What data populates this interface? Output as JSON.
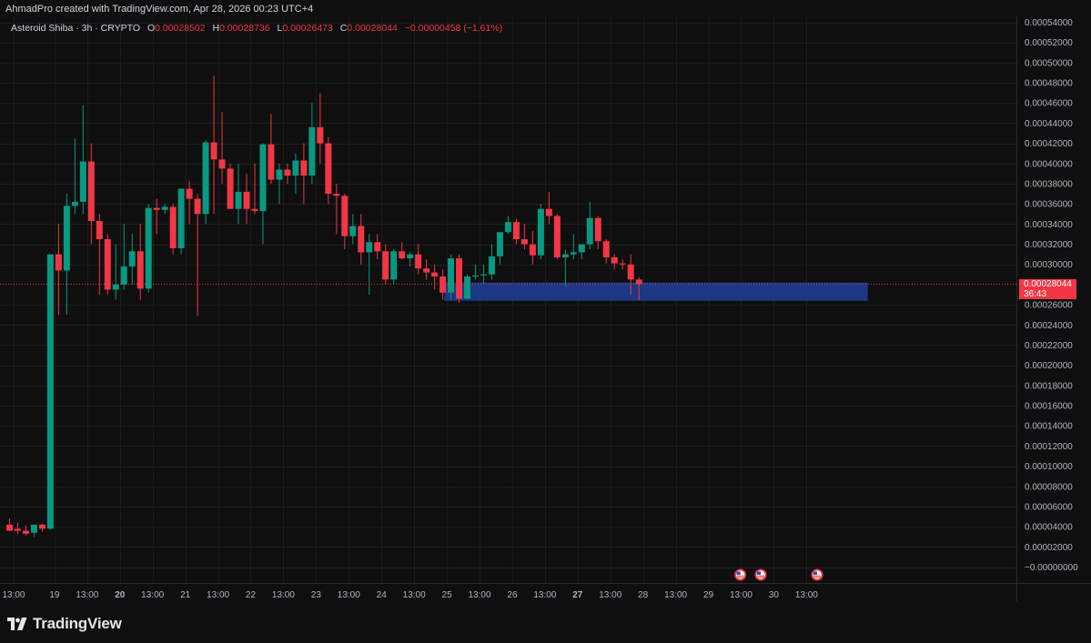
{
  "header": {
    "attribution": "AhmadPro created with TradingView.com, Apr 28, 2026 00:23 UTC+4"
  },
  "legend": {
    "symbol": "Asteroid Shiba · 3h · CRYPTO",
    "open_label": "O",
    "open": "0.00028502",
    "high_label": "H",
    "high": "0.00028736",
    "low_label": "L",
    "low": "0.00026473",
    "close_label": "C",
    "close": "0.00028044",
    "change": "−0.00000458 (−1.61%)"
  },
  "price_label": {
    "price": "0.00028044",
    "countdown": "36:43"
  },
  "brand": {
    "name": "TradingView",
    "logo_icon": "tradingview-logo-icon"
  },
  "colors": {
    "up": "#089981",
    "down": "#f23645",
    "zone": "#1e3a8a",
    "background": "#0f0f0f"
  },
  "chart_data": {
    "type": "candlestick",
    "timeframe": "3h",
    "y_ticks": [
      "0.00054000",
      "0.00052000",
      "0.00050000",
      "0.00048000",
      "0.00046000",
      "0.00044000",
      "0.00042000",
      "0.00040000",
      "0.00038000",
      "0.00036000",
      "0.00034000",
      "0.00032000",
      "0.00030000",
      "0.00028044",
      "0.00026000",
      "0.00024000",
      "0.00022000",
      "0.00020000",
      "0.00018000",
      "0.00016000",
      "0.00014000",
      "0.00012000",
      "0.00010000",
      "0.00008000",
      "0.00006000",
      "0.00004000",
      "0.00002000",
      "−0.00000000"
    ],
    "y_tick_values": [
      0.00054,
      0.00052,
      0.0005,
      0.00048,
      0.00046,
      0.00044,
      0.00042,
      0.0004,
      0.00038,
      0.00036,
      0.00034,
      0.00032,
      0.0003,
      0.00028044,
      0.00026,
      0.00024,
      0.00022,
      0.0002,
      0.00018,
      0.00016,
      0.00014,
      0.00012,
      0.0001,
      8e-05,
      6e-05,
      4e-05,
      2e-05,
      0
    ],
    "ylim": [
      -1e-06,
      0.000545
    ],
    "x_ticks": [
      {
        "label": "13:00",
        "bar": 0.5,
        "bold": false
      },
      {
        "label": "19",
        "bar": 5.5,
        "bold": false
      },
      {
        "label": "13:00",
        "bar": 9.5,
        "bold": false
      },
      {
        "label": "20",
        "bar": 13.5,
        "bold": true
      },
      {
        "label": "13:00",
        "bar": 17.5,
        "bold": false
      },
      {
        "label": "21",
        "bar": 21.5,
        "bold": false
      },
      {
        "label": "13:00",
        "bar": 25.5,
        "bold": false
      },
      {
        "label": "22",
        "bar": 29.5,
        "bold": false
      },
      {
        "label": "13:00",
        "bar": 33.5,
        "bold": false
      },
      {
        "label": "23",
        "bar": 37.5,
        "bold": false
      },
      {
        "label": "13:00",
        "bar": 41.5,
        "bold": false
      },
      {
        "label": "24",
        "bar": 45.5,
        "bold": false
      },
      {
        "label": "13:00",
        "bar": 49.5,
        "bold": false
      },
      {
        "label": "25",
        "bar": 53.5,
        "bold": false
      },
      {
        "label": "13:00",
        "bar": 57.5,
        "bold": false
      },
      {
        "label": "26",
        "bar": 61.5,
        "bold": false
      },
      {
        "label": "13:00",
        "bar": 65.5,
        "bold": false
      },
      {
        "label": "27",
        "bar": 69.5,
        "bold": true
      },
      {
        "label": "13:00",
        "bar": 73.5,
        "bold": false
      },
      {
        "label": "28",
        "bar": 77.5,
        "bold": false
      },
      {
        "label": "13:00",
        "bar": 81.5,
        "bold": false
      },
      {
        "label": "29",
        "bar": 85.5,
        "bold": false
      },
      {
        "label": "13:00",
        "bar": 89.5,
        "bold": false
      },
      {
        "label": "30",
        "bar": 93.5,
        "bold": false
      },
      {
        "label": "13:00",
        "bar": 97.5,
        "bold": false
      }
    ],
    "candles": [
      {
        "o": 4.2e-05,
        "h": 4.8e-05,
        "l": 3.6e-05,
        "c": 3.6e-05
      },
      {
        "o": 3.8e-05,
        "h": 4.4e-05,
        "l": 3.3e-05,
        "c": 3.6e-05
      },
      {
        "o": 3.6e-05,
        "h": 4.1e-05,
        "l": 3.1e-05,
        "c": 3.3e-05
      },
      {
        "o": 3.4e-05,
        "h": 4.2e-05,
        "l": 3e-05,
        "c": 4.2e-05
      },
      {
        "o": 4.2e-05,
        "h": 4.3e-05,
        "l": 3.5e-05,
        "c": 3.8e-05
      },
      {
        "o": 3.8e-05,
        "h": 0.00031,
        "l": 3.7e-05,
        "c": 0.00031
      },
      {
        "o": 0.00031,
        "h": 0.00034,
        "l": 0.00025,
        "c": 0.000294
      },
      {
        "o": 0.000294,
        "h": 0.00037,
        "l": 0.00025,
        "c": 0.000358
      },
      {
        "o": 0.000358,
        "h": 0.000425,
        "l": 0.00035,
        "c": 0.000362
      },
      {
        "o": 0.000362,
        "h": 0.000458,
        "l": 0.00035,
        "c": 0.000402
      },
      {
        "o": 0.000402,
        "h": 0.00042,
        "l": 0.00032,
        "c": 0.000343
      },
      {
        "o": 0.000343,
        "h": 0.00035,
        "l": 0.00027,
        "c": 0.000325
      },
      {
        "o": 0.000325,
        "h": 0.00033,
        "l": 0.00027,
        "c": 0.000275
      },
      {
        "o": 0.000275,
        "h": 0.00032,
        "l": 0.000265,
        "c": 0.00028
      },
      {
        "o": 0.00028,
        "h": 0.00034,
        "l": 0.000275,
        "c": 0.000298
      },
      {
        "o": 0.000298,
        "h": 0.00033,
        "l": 0.00028,
        "c": 0.000313
      },
      {
        "o": 0.000313,
        "h": 0.00034,
        "l": 0.000265,
        "c": 0.000276
      },
      {
        "o": 0.000276,
        "h": 0.00036,
        "l": 0.000272,
        "c": 0.000356
      },
      {
        "o": 0.000356,
        "h": 0.000365,
        "l": 0.00033,
        "c": 0.000354
      },
      {
        "o": 0.000354,
        "h": 0.00036,
        "l": 0.00035,
        "c": 0.000357
      },
      {
        "o": 0.000357,
        "h": 0.00036,
        "l": 0.00031,
        "c": 0.000316
      },
      {
        "o": 0.000316,
        "h": 0.000375,
        "l": 0.00031,
        "c": 0.000375
      },
      {
        "o": 0.000375,
        "h": 0.000383,
        "l": 0.00034,
        "c": 0.000365
      },
      {
        "o": 0.000365,
        "h": 0.00037,
        "l": 0.000249,
        "c": 0.00035
      },
      {
        "o": 0.00035,
        "h": 0.000423,
        "l": 0.00034,
        "c": 0.000421
      },
      {
        "o": 0.000421,
        "h": 0.000487,
        "l": 0.00035,
        "c": 0.000404
      },
      {
        "o": 0.000404,
        "h": 0.000451,
        "l": 0.00038,
        "c": 0.000395
      },
      {
        "o": 0.000395,
        "h": 0.0004,
        "l": 0.00036,
        "c": 0.000355
      },
      {
        "o": 0.000355,
        "h": 0.0004,
        "l": 0.00034,
        "c": 0.000372
      },
      {
        "o": 0.000372,
        "h": 0.00039,
        "l": 0.00034,
        "c": 0.000355
      },
      {
        "o": 0.000355,
        "h": 0.0004,
        "l": 0.00035,
        "c": 0.000353
      },
      {
        "o": 0.000353,
        "h": 0.00042,
        "l": 0.00032,
        "c": 0.000419
      },
      {
        "o": 0.000419,
        "h": 0.000449,
        "l": 0.00038,
        "c": 0.000384
      },
      {
        "o": 0.000384,
        "h": 0.0004,
        "l": 0.00036,
        "c": 0.000394
      },
      {
        "o": 0.000394,
        "h": 0.0004,
        "l": 0.00038,
        "c": 0.000388
      },
      {
        "o": 0.000388,
        "h": 0.00041,
        "l": 0.00037,
        "c": 0.000403
      },
      {
        "o": 0.000403,
        "h": 0.00042,
        "l": 0.00036,
        "c": 0.000388
      },
      {
        "o": 0.000388,
        "h": 0.00046,
        "l": 0.00038,
        "c": 0.000436
      },
      {
        "o": 0.000436,
        "h": 0.00047,
        "l": 0.0004,
        "c": 0.00042
      },
      {
        "o": 0.00042,
        "h": 0.000426,
        "l": 0.00036,
        "c": 0.00037
      },
      {
        "o": 0.00037,
        "h": 0.00038,
        "l": 0.00033,
        "c": 0.000368
      },
      {
        "o": 0.000368,
        "h": 0.00037,
        "l": 0.000315,
        "c": 0.000328
      },
      {
        "o": 0.000328,
        "h": 0.00035,
        "l": 0.00032,
        "c": 0.000338
      },
      {
        "o": 0.000338,
        "h": 0.00035,
        "l": 0.0003,
        "c": 0.000312
      },
      {
        "o": 0.000312,
        "h": 0.00033,
        "l": 0.00027,
        "c": 0.000322
      },
      {
        "o": 0.000322,
        "h": 0.00033,
        "l": 0.000305,
        "c": 0.000313
      },
      {
        "o": 0.000313,
        "h": 0.00032,
        "l": 0.00028,
        "c": 0.000285
      },
      {
        "o": 0.000285,
        "h": 0.000315,
        "l": 0.00028,
        "c": 0.000313
      },
      {
        "o": 0.000313,
        "h": 0.000322,
        "l": 0.000305,
        "c": 0.000306
      },
      {
        "o": 0.000306,
        "h": 0.000312,
        "l": 0.000298,
        "c": 0.00031
      },
      {
        "o": 0.00031,
        "h": 0.00032,
        "l": 0.00029,
        "c": 0.000296
      },
      {
        "o": 0.000296,
        "h": 0.000305,
        "l": 0.000285,
        "c": 0.000292
      },
      {
        "o": 0.000292,
        "h": 0.0003,
        "l": 0.000275,
        "c": 0.000288
      },
      {
        "o": 0.000288,
        "h": 0.000295,
        "l": 0.000265,
        "c": 0.000272
      },
      {
        "o": 0.000272,
        "h": 0.00031,
        "l": 0.000265,
        "c": 0.000306
      },
      {
        "o": 0.000306,
        "h": 0.00031,
        "l": 0.000262,
        "c": 0.000266
      },
      {
        "o": 0.000266,
        "h": 0.00029,
        "l": 0.000265,
        "c": 0.000288
      },
      {
        "o": 0.000288,
        "h": 0.0003,
        "l": 0.000285,
        "c": 0.000289
      },
      {
        "o": 0.000289,
        "h": 0.0003,
        "l": 0.00028,
        "c": 0.00029
      },
      {
        "o": 0.00029,
        "h": 0.00032,
        "l": 0.000285,
        "c": 0.000308
      },
      {
        "o": 0.000308,
        "h": 0.00033,
        "l": 0.0003,
        "c": 0.000332
      },
      {
        "o": 0.000332,
        "h": 0.000348,
        "l": 0.00033,
        "c": 0.000342
      },
      {
        "o": 0.000342,
        "h": 0.000345,
        "l": 0.00032,
        "c": 0.000325
      },
      {
        "o": 0.000325,
        "h": 0.00034,
        "l": 0.000315,
        "c": 0.00032
      },
      {
        "o": 0.00032,
        "h": 0.000333,
        "l": 0.0003,
        "c": 0.000309
      },
      {
        "o": 0.000309,
        "h": 0.00036,
        "l": 0.000305,
        "c": 0.000355
      },
      {
        "o": 0.000355,
        "h": 0.000372,
        "l": 0.00034,
        "c": 0.000348
      },
      {
        "o": 0.000348,
        "h": 0.00035,
        "l": 0.000305,
        "c": 0.000307
      },
      {
        "o": 0.000307,
        "h": 0.000315,
        "l": 0.000278,
        "c": 0.00031
      },
      {
        "o": 0.00031,
        "h": 0.00033,
        "l": 0.000305,
        "c": 0.000312
      },
      {
        "o": 0.000312,
        "h": 0.00032,
        "l": 0.000305,
        "c": 0.00032
      },
      {
        "o": 0.00032,
        "h": 0.000362,
        "l": 0.000315,
        "c": 0.000346
      },
      {
        "o": 0.000346,
        "h": 0.000348,
        "l": 0.000315,
        "c": 0.000323
      },
      {
        "o": 0.000323,
        "h": 0.000325,
        "l": 0.000301,
        "c": 0.000307
      },
      {
        "o": 0.000307,
        "h": 0.00031,
        "l": 0.000295,
        "c": 0.000301
      },
      {
        "o": 0.000301,
        "h": 0.000305,
        "l": 0.000295,
        "c": 0.0003
      },
      {
        "o": 0.0003,
        "h": 0.00031,
        "l": 0.00027,
        "c": 0.000285
      },
      {
        "o": 0.000285,
        "h": 0.0002874,
        "l": 0.0002647,
        "c": 0.0002804
      }
    ],
    "zone": {
      "from_bar": 53.2,
      "to_bar": 105.0,
      "top": 0.000282,
      "bottom": 0.000264
    },
    "last_price": 0.00028044,
    "event_markers": [
      {
        "bar": 89.4
      },
      {
        "bar": 91.9
      },
      {
        "bar": 98.8
      }
    ]
  }
}
